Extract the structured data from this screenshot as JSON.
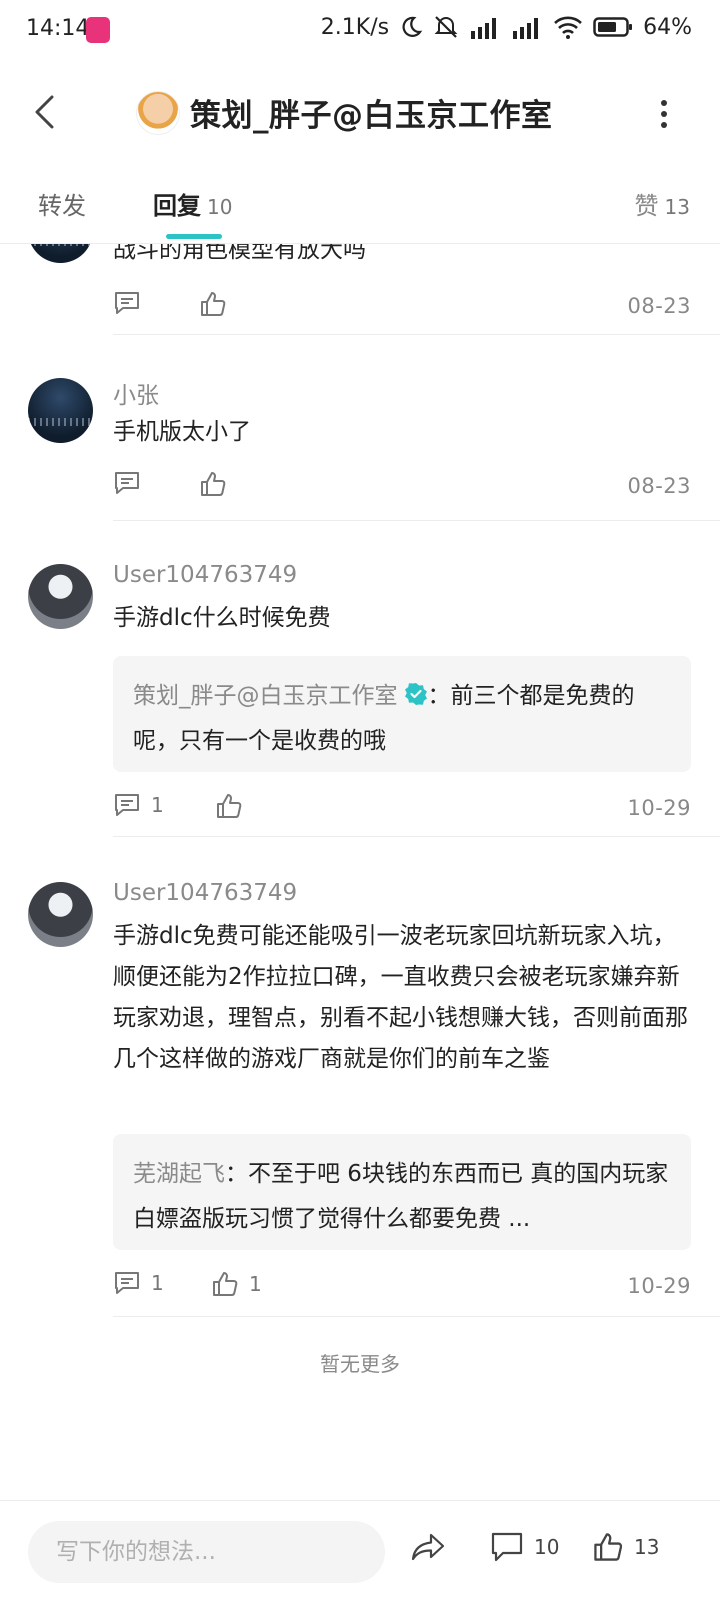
{
  "status_bar": {
    "time": "14:14",
    "network_speed": "2.1K/s",
    "battery": "64%"
  },
  "header": {
    "title": "策划_胖子@白玉京工作室"
  },
  "tabs": [
    {
      "label": "转发",
      "count": ""
    },
    {
      "label": "回复",
      "count": "10"
    },
    {
      "label": "赞",
      "count": "13"
    }
  ],
  "comments": [
    {
      "user": "",
      "text": "战斗的角色模型有放大吗",
      "reply_count": "",
      "like_count": "",
      "date": "08-23"
    },
    {
      "user": "小张",
      "text": "手机版太小了",
      "reply_count": "",
      "like_count": "",
      "date": "08-23"
    },
    {
      "user": "User104763749",
      "text": "手游dlc什么时候免费",
      "reply": {
        "user": "策划_胖子@白玉京工作室",
        "text": "：前三个都是免费的呢，只有一个是收费的哦"
      },
      "reply_count": "1",
      "like_count": "",
      "date": "10-29"
    },
    {
      "user": "User104763749",
      "text": "手游dlc免费可能还能吸引一波老玩家回坑新玩家入坑，顺便还能为2作拉拉口碑，一直收费只会被老玩家嫌弃新玩家劝退，理智点，别看不起小钱想赚大钱，否则前面那几个这样做的游戏厂商就是你们的前车之鉴",
      "reply": {
        "user": "芜湖起飞",
        "text": "：不至于吧 6块钱的东西而已 真的国内玩家白嫖盗版玩习惯了觉得什么都要免费 ..."
      },
      "reply_count": "1",
      "like_count": "1",
      "date": "10-29"
    }
  ],
  "list_footer": "暂无更多",
  "bottom_bar": {
    "input_placeholder": "写下你的想法...",
    "comment_count": "10",
    "like_count": "13"
  }
}
